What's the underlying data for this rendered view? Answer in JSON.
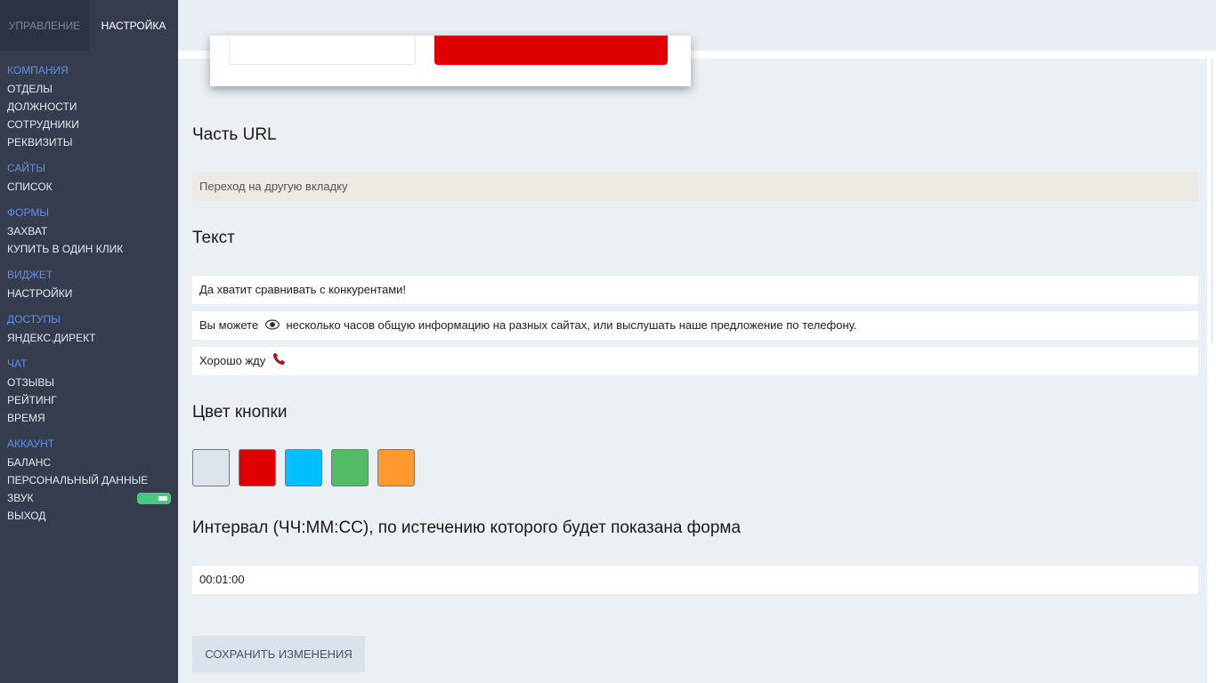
{
  "sidebar": {
    "tabs": [
      {
        "label": "УПРАВЛЕНИЕ"
      },
      {
        "label": "НАСТРОЙКА"
      }
    ],
    "sections": [
      {
        "heading": "КОМПАНИЯ",
        "items": [
          "ОТДЕЛЫ",
          "ДОЛЖНОСТИ",
          "СОТРУДНИКИ",
          "РЕКВИЗИТЫ"
        ]
      },
      {
        "heading": "САЙТЫ",
        "items": [
          "СПИСОК"
        ]
      },
      {
        "heading": "ФОРМЫ",
        "items": [
          "ЗАХВАТ",
          "КУПИТЬ В ОДИН КЛИК"
        ]
      },
      {
        "heading": "ВИДЖЕТ",
        "items": [
          "НАСТРОЙКИ"
        ]
      },
      {
        "heading": "ДОСТУПЫ",
        "items": [
          "ЯНДЕКС.ДИРЕКТ"
        ]
      },
      {
        "heading": "ЧАТ",
        "items": [
          "ОТЗЫВЫ",
          "РЕЙТИНГ",
          "ВРЕМЯ"
        ]
      },
      {
        "heading": "АККАУНТ",
        "items": [
          "БАЛАНС",
          "ПЕРСОНАЛЬНЫЙ ДАННЫЕ",
          "ЗВУК",
          "ВЫХОД"
        ]
      }
    ],
    "sound_toggle_on": true,
    "toggle_color": "#45c97e"
  },
  "form": {
    "url_label": "Часть URL",
    "url_value": "Переход на другую вкладку",
    "text_label": "Текст",
    "text_line1": "Да хватит сравнивать с конкурентами!",
    "text_line2_before": "Вы можете",
    "text_line2_icon": "eye-icon",
    "text_line2_after": "несколько часов общую информацию на разных сайтах, или выслушать наше предложение по телефону.",
    "text_line3": "Хорошо жду",
    "text_line3_icon": "phone-icon",
    "color_label": "Цвет кнопки",
    "colors": [
      "#dde5ec",
      "#e00000",
      "#00bfff",
      "#52bc64",
      "#ff982d"
    ],
    "interval_label": "Интервал (ЧЧ:ММ:СС), по истечению которого будет показана форма",
    "interval_value": "00:01:00",
    "save_label": "СОХРАНИТЬ ИЗМЕНЕНИЯ"
  },
  "preview": {
    "button_color": "#e00000"
  }
}
